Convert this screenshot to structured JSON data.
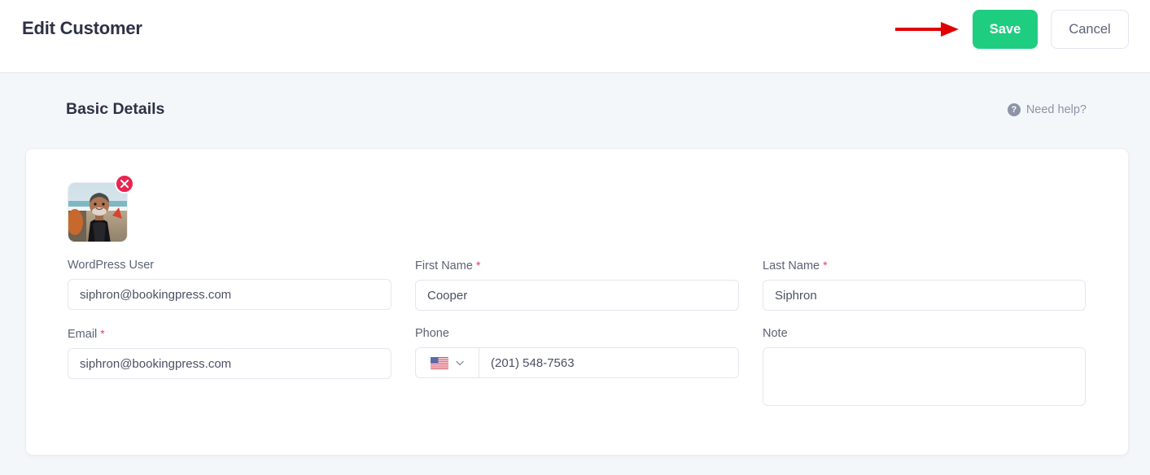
{
  "header": {
    "title": "Edit Customer",
    "save_label": "Save",
    "cancel_label": "Cancel",
    "save_color": "#1fcd81",
    "annotation_arrow_color": "#e00000"
  },
  "section": {
    "title": "Basic Details",
    "help_label": "Need help?",
    "help_icon": "question-circle-icon"
  },
  "avatar": {
    "remove_icon": "close-x-icon",
    "remove_badge_color": "#e8264f",
    "alt": "customer-profile-photo"
  },
  "form": {
    "fields": [
      {
        "name": "wordpress-user",
        "label": "WordPress User",
        "required": false,
        "value": "siphron@bookingpress.com",
        "placeholder": "WordPress User"
      },
      {
        "name": "first-name",
        "label": "First Name",
        "required": true,
        "required_mark": "*",
        "value": "Cooper",
        "placeholder": "First Name"
      },
      {
        "name": "last-name",
        "label": "Last Name",
        "required": true,
        "required_mark": "*",
        "value": "Siphron",
        "placeholder": "Last Name"
      },
      {
        "name": "email",
        "label": "Email",
        "required": true,
        "required_mark": "*",
        "value": "siphron@bookingpress.com",
        "placeholder": "Email"
      },
      {
        "name": "phone",
        "label": "Phone",
        "required": false,
        "value": "(201) 548-7563",
        "placeholder": "Phone",
        "country_flag": "us-flag-icon",
        "country_dropdown_icon": "chevron-down-icon"
      },
      {
        "name": "note",
        "label": "Note",
        "required": false,
        "value": "",
        "placeholder": ""
      }
    ]
  }
}
